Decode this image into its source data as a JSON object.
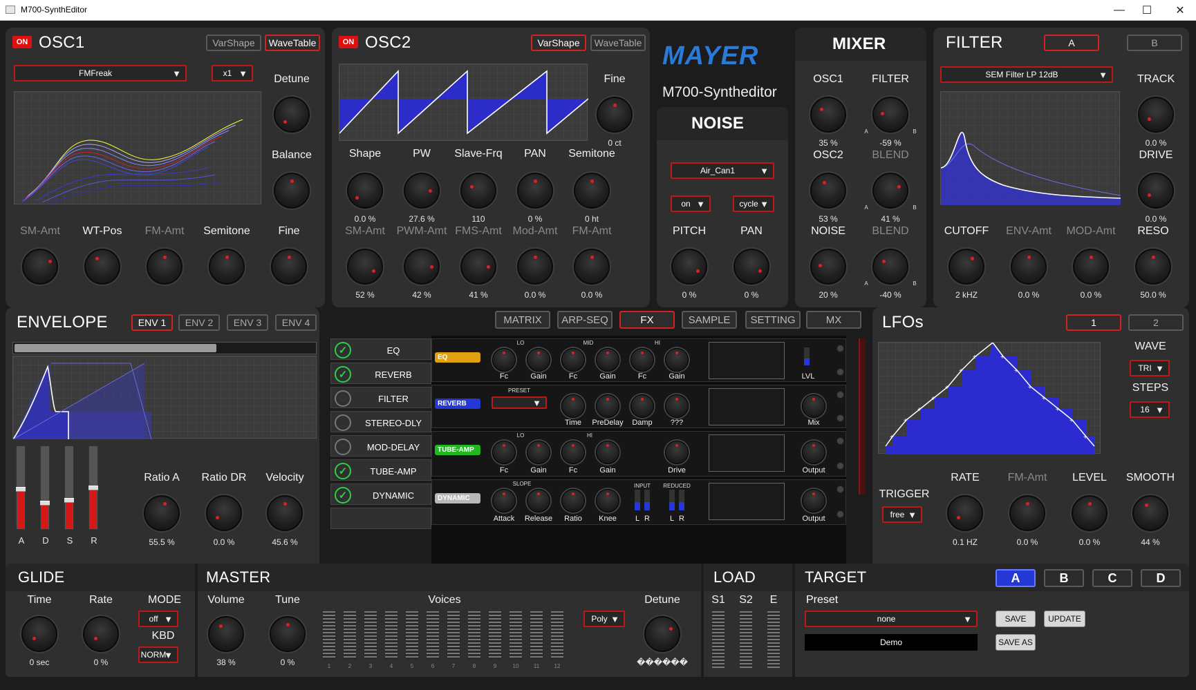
{
  "window": {
    "title": "M700-SynthEditor",
    "minimize": "—",
    "maximize": "☐",
    "close": "✕"
  },
  "osc1": {
    "title": "OSC1",
    "on": "ON",
    "varshape": "VarShape",
    "wavetable": "WaveTable",
    "wave": "FMFreak",
    "mult": "x1",
    "detune": "Detune",
    "balance": "Balance",
    "sm_amt": "SM-Amt",
    "wt_pos": "WT-Pos",
    "fm_amt": "FM-Amt",
    "semitone": "Semitone",
    "fine": "Fine"
  },
  "osc2": {
    "title": "OSC2",
    "on": "ON",
    "varshape": "VarShape",
    "wavetable": "WaveTable",
    "fine": "Fine",
    "fine_val": "0 ct",
    "knobs_top": [
      {
        "label": "Shape",
        "val": "0.0 %"
      },
      {
        "label": "PW",
        "val": "27.6 %"
      },
      {
        "label": "Slave-Frq",
        "val": "110"
      },
      {
        "label": "PAN",
        "val": "0 %"
      },
      {
        "label": "Semitone",
        "val": "0 ht"
      }
    ],
    "knobs_bot": [
      {
        "label": "SM-Amt",
        "val": "52 %"
      },
      {
        "label": "PWM-Amt",
        "val": "42 %"
      },
      {
        "label": "FMS-Amt",
        "val": "41 %"
      },
      {
        "label": "Mod-Amt",
        "val": "0.0 %"
      },
      {
        "label": "FM-Amt",
        "val": "0.0 %"
      }
    ]
  },
  "logo": {
    "brand": "MAYER",
    "sub": "M700-Syntheditor"
  },
  "noise": {
    "title": "NOISE",
    "type": "Air_Can1",
    "on": "on",
    "cycle": "cycle",
    "pitch": "PITCH",
    "pitch_val": "0 %",
    "pan": "PAN",
    "pan_val": "0 %"
  },
  "mixer": {
    "title": "MIXER",
    "osc1": "OSC1",
    "osc1_val": "35 %",
    "filter": "FILTER",
    "filter_val": "-59 %",
    "osc2": "OSC2",
    "osc2_val": "53 %",
    "blend1": "BLEND",
    "blend1_val": "41 %",
    "noise": "NOISE",
    "noise_val": "20 %",
    "blend2": "BLEND",
    "blend2_val": "-40 %",
    "a": "A",
    "b": "B"
  },
  "filter": {
    "title": "FILTER",
    "tab_a": "A",
    "tab_b": "B",
    "type": "SEM Filter LP 12dB",
    "track": "TRACK",
    "track_val": "0.0 %",
    "drive": "DRIVE",
    "drive_val": "0.0 %",
    "cutoff": "CUTOFF",
    "cutoff_val": "2 kHZ",
    "env_amt": "ENV-Amt",
    "env_val": "0.0 %",
    "mod_amt": "MOD-Amt",
    "mod_val": "0.0 %",
    "reso": "RESO",
    "reso_val": "50.0 %"
  },
  "envelope": {
    "title": "ENVELOPE",
    "tabs": [
      "ENV 1",
      "ENV 2",
      "ENV 3",
      "ENV 4"
    ],
    "a": "A",
    "d": "D",
    "s": "S",
    "r": "R",
    "ratio_a": "Ratio A",
    "ratio_a_val": "55.5 %",
    "ratio_dr": "Ratio DR",
    "ratio_dr_val": "0.0 %",
    "velocity": "Velocity",
    "velocity_val": "45.6 %"
  },
  "center_tabs": [
    "MATRIX",
    "ARP-SEQ",
    "FX",
    "SAMPLE",
    "SETTING",
    "MX"
  ],
  "fx": {
    "rows": [
      {
        "name": "EQ",
        "on": true
      },
      {
        "name": "REVERB",
        "on": true
      },
      {
        "name": "FILTER",
        "on": false
      },
      {
        "name": "STEREO-DLY",
        "on": false
      },
      {
        "name": "MOD-DELAY",
        "on": false
      },
      {
        "name": "TUBE-AMP",
        "on": true
      },
      {
        "name": "DYNAMIC",
        "on": true
      },
      {
        "name": "",
        "on": false
      }
    ],
    "eq": {
      "tag": "EQ",
      "lo": "LO",
      "mid": "MID",
      "hi": "HI",
      "knobs": [
        "Fc",
        "Gain",
        "Fc",
        "Gain",
        "Fc",
        "Gain"
      ],
      "lvl": "LVL"
    },
    "reverb": {
      "tag": "REVERB",
      "preset": "PRESET",
      "knobs": [
        "Time",
        "PreDelay",
        "Damp",
        "???"
      ],
      "mix": "Mix"
    },
    "tube": {
      "tag": "TUBE-AMP",
      "lo": "LO",
      "hi": "HI",
      "knobs": [
        "Fc",
        "Gain",
        "Fc",
        "Gain"
      ],
      "drive": "Drive",
      "output": "Output"
    },
    "dynamic": {
      "tag": "DYNAMIC",
      "slope": "SLOPE",
      "knobs": [
        "Attack",
        "Release",
        "Ratio",
        "Knee"
      ],
      "input": "INPUT",
      "reduced": "REDUCED",
      "l": "L",
      "r": "R",
      "output": "Output"
    }
  },
  "lfo": {
    "title": "LFOs",
    "tab1": "1",
    "tab2": "2",
    "wave": "WAVE",
    "wave_val": "TRI",
    "steps": "STEPS",
    "steps_val": "16",
    "trigger": "TRIGGER",
    "trigger_val": "free",
    "rate": "RATE",
    "rate_val": "0.1 HZ",
    "fm_amt": "FM-Amt",
    "fm_val": "0.0 %",
    "level": "LEVEL",
    "level_val": "0.0 %",
    "smooth": "SMOOTH",
    "smooth_val": "44 %"
  },
  "glide": {
    "title": "GLIDE",
    "time": "Time",
    "time_val": "0 sec",
    "rate": "Rate",
    "rate_val": "0 %",
    "mode": "MODE",
    "mode_val": "off",
    "kbd": "KBD",
    "kbd_val": "NORM"
  },
  "master": {
    "title": "MASTER",
    "volume": "Volume",
    "volume_val": "38 %",
    "tune": "Tune",
    "tune_val": "0 %",
    "voices": "Voices",
    "voice_nums": [
      "1",
      "2",
      "3",
      "4",
      "5",
      "6",
      "7",
      "8",
      "9",
      "10",
      "11",
      "12"
    ],
    "poly": "Poly",
    "detune": "Detune",
    "detune_val": "������"
  },
  "load": {
    "title": "LOAD",
    "s1": "S1",
    "s2": "S2",
    "e": "E"
  },
  "target": {
    "title": "TARGET",
    "tabs": [
      "A",
      "B",
      "C",
      "D"
    ],
    "preset": "Preset",
    "preset_val": "none",
    "name": "Demo",
    "save": "SAVE",
    "update": "UPDATE",
    "save_as": "SAVE AS"
  },
  "colors": {
    "accent_red": "#d42222",
    "wave_blue": "#2b2bd0",
    "select_blue": "#2438d6"
  }
}
